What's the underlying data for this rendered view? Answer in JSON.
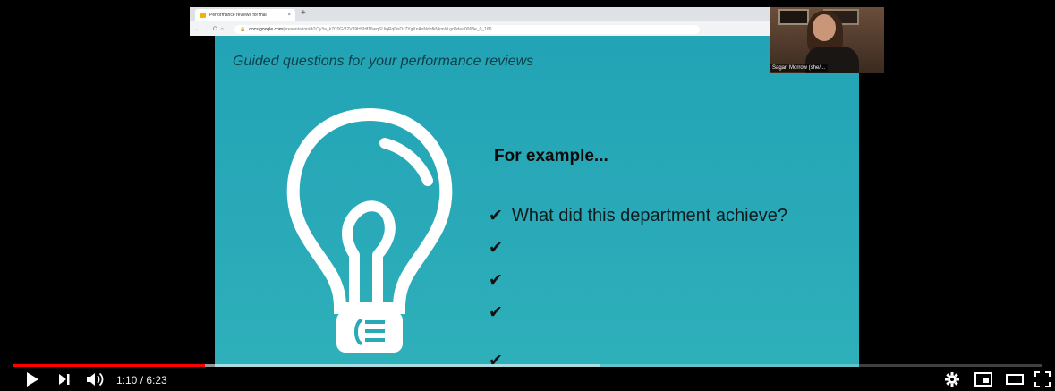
{
  "browser": {
    "tab_title": "Performance reviews for mai",
    "address_prefix": "docs.google.com",
    "address_rest": "/presentation/d/1Cy3a_k7C0G/32V39HSHf16wqSUiqRqDsDz7YgXnAsNdhfkNkm/d gd9dea0068e_0_166"
  },
  "slide": {
    "title": "Guided questions for your performance reviews",
    "example_heading": "For example...",
    "check_mark": "✔",
    "question_1": "What did this department achieve?"
  },
  "webcam": {
    "name_label": "Sagan Morrow (she/..."
  },
  "player": {
    "time_display": "1:10 / 6:23",
    "progress_fraction": 0.187,
    "buffer_fraction": 0.57
  }
}
